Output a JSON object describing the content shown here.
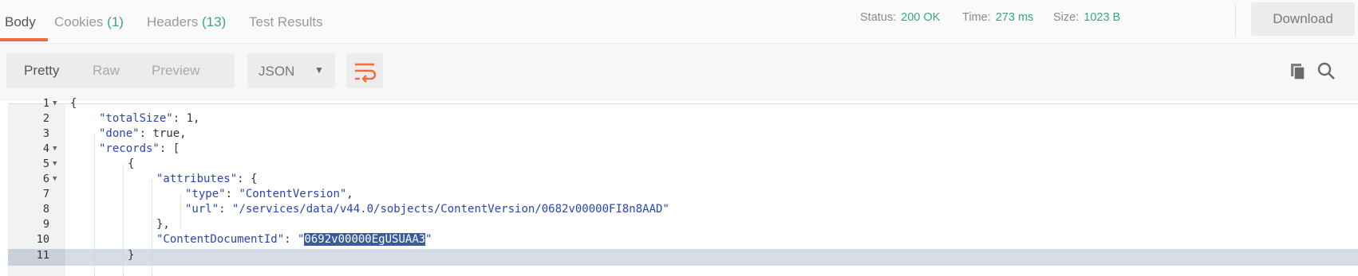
{
  "tabs": [
    {
      "label": "Body",
      "count": ""
    },
    {
      "label": "Cookies",
      "count": "(1)"
    },
    {
      "label": "Headers",
      "count": "(13)"
    },
    {
      "label": "Test Results",
      "count": ""
    }
  ],
  "status": {
    "status_label": "Status:",
    "status_value": "200 OK",
    "time_label": "Time:",
    "time_value": "273 ms",
    "size_label": "Size:",
    "size_value": "1023 B"
  },
  "download_label": "Download",
  "view_modes": [
    "Pretty",
    "Raw",
    "Preview"
  ],
  "format_select": {
    "value": "JSON"
  },
  "icons": {
    "wrap": "wrap-lines-icon",
    "copy": "copy-icon",
    "search": "search-icon",
    "caret": "caret-down-icon"
  },
  "colors": {
    "accent": "#f26b3a",
    "success": "#3aa77a",
    "json_key": "#2b45b3"
  },
  "code": {
    "line_numbers": [
      "1",
      "2",
      "3",
      "4",
      "5",
      "6",
      "7",
      "8",
      "9",
      "10",
      "11"
    ],
    "l1": "{",
    "l2_key": "\"totalSize\"",
    "l2_rest": ": 1,",
    "l3_key": "\"done\"",
    "l3_rest": ": true,",
    "l4_key": "\"records\"",
    "l4_rest": ": [",
    "l5": "{",
    "l6_key": "\"attributes\"",
    "l6_rest": ": {",
    "l7_key": "\"type\"",
    "l7_sep": ": ",
    "l7_val": "\"ContentVersion\"",
    "l7_end": ",",
    "l8_key": "\"url\"",
    "l8_sep": ": ",
    "l8_val": "\"/services/data/v44.0/sobjects/ContentVersion/0682v00000FI8n8AAD\"",
    "l9": "},",
    "l10_key": "\"ContentDocumentId\"",
    "l10_sep": ": ",
    "l10_q": "\"",
    "l10_sel": "0692v00000EgUSUAA3",
    "l10_end": "\"",
    "l11": "}"
  }
}
